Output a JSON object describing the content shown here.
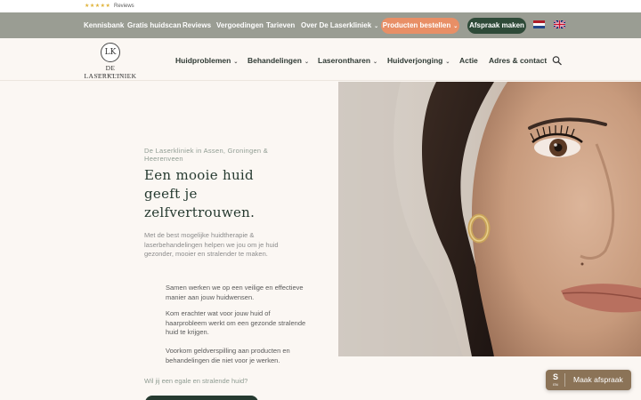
{
  "review_strip": {
    "stars": "★★★★★",
    "label": "Reviews"
  },
  "top_nav": {
    "items": [
      "Kennisbank",
      "Gratis huidscan",
      "Reviews",
      "Vergoedingen",
      "Tarieven",
      "Over De Laserkliniek"
    ],
    "order_button": "Producten bestellen",
    "appointment_button": "Afspraak maken",
    "colors": {
      "bar": "#9a9d93",
      "order": "#e88f66",
      "appointment": "#2e4a38"
    }
  },
  "header": {
    "logo_mark": "LK",
    "logo_name": "DE LASERKLINIEK",
    "logo_sub": "huid therapie",
    "menu": [
      "Huidproblemen",
      "Behandelingen",
      "Laserontharen",
      "Huidverjonging",
      "Actie",
      "Adres & contact"
    ]
  },
  "hero": {
    "kicker": "De Laserkliniek in Assen, Groningen & Heerenveen",
    "title": "Een mooie huid geeft je zelfvertrouwen.",
    "body": "Met de best mogelijke huidtherapie & laserbehandelingen helpen we jou om je huid gezonder, mooier en stralender te maken.",
    "points": [
      "Samen werken we op een veilige en effectieve manier aan jouw huidwensen.",
      "Kom erachter wat voor jouw huid of haarprobleem werkt om een gezonde stralende huid te krijgen.",
      "Voorkom geldverspilling aan producten en behandelingen die niet voor je werken."
    ],
    "question": "Wil jij een egale en stralende huid?",
    "accent": "#263a30"
  },
  "chat_widget": {
    "logo": "S",
    "lang": "EN",
    "label": "Maak afspraak",
    "color": "#8b7357"
  }
}
